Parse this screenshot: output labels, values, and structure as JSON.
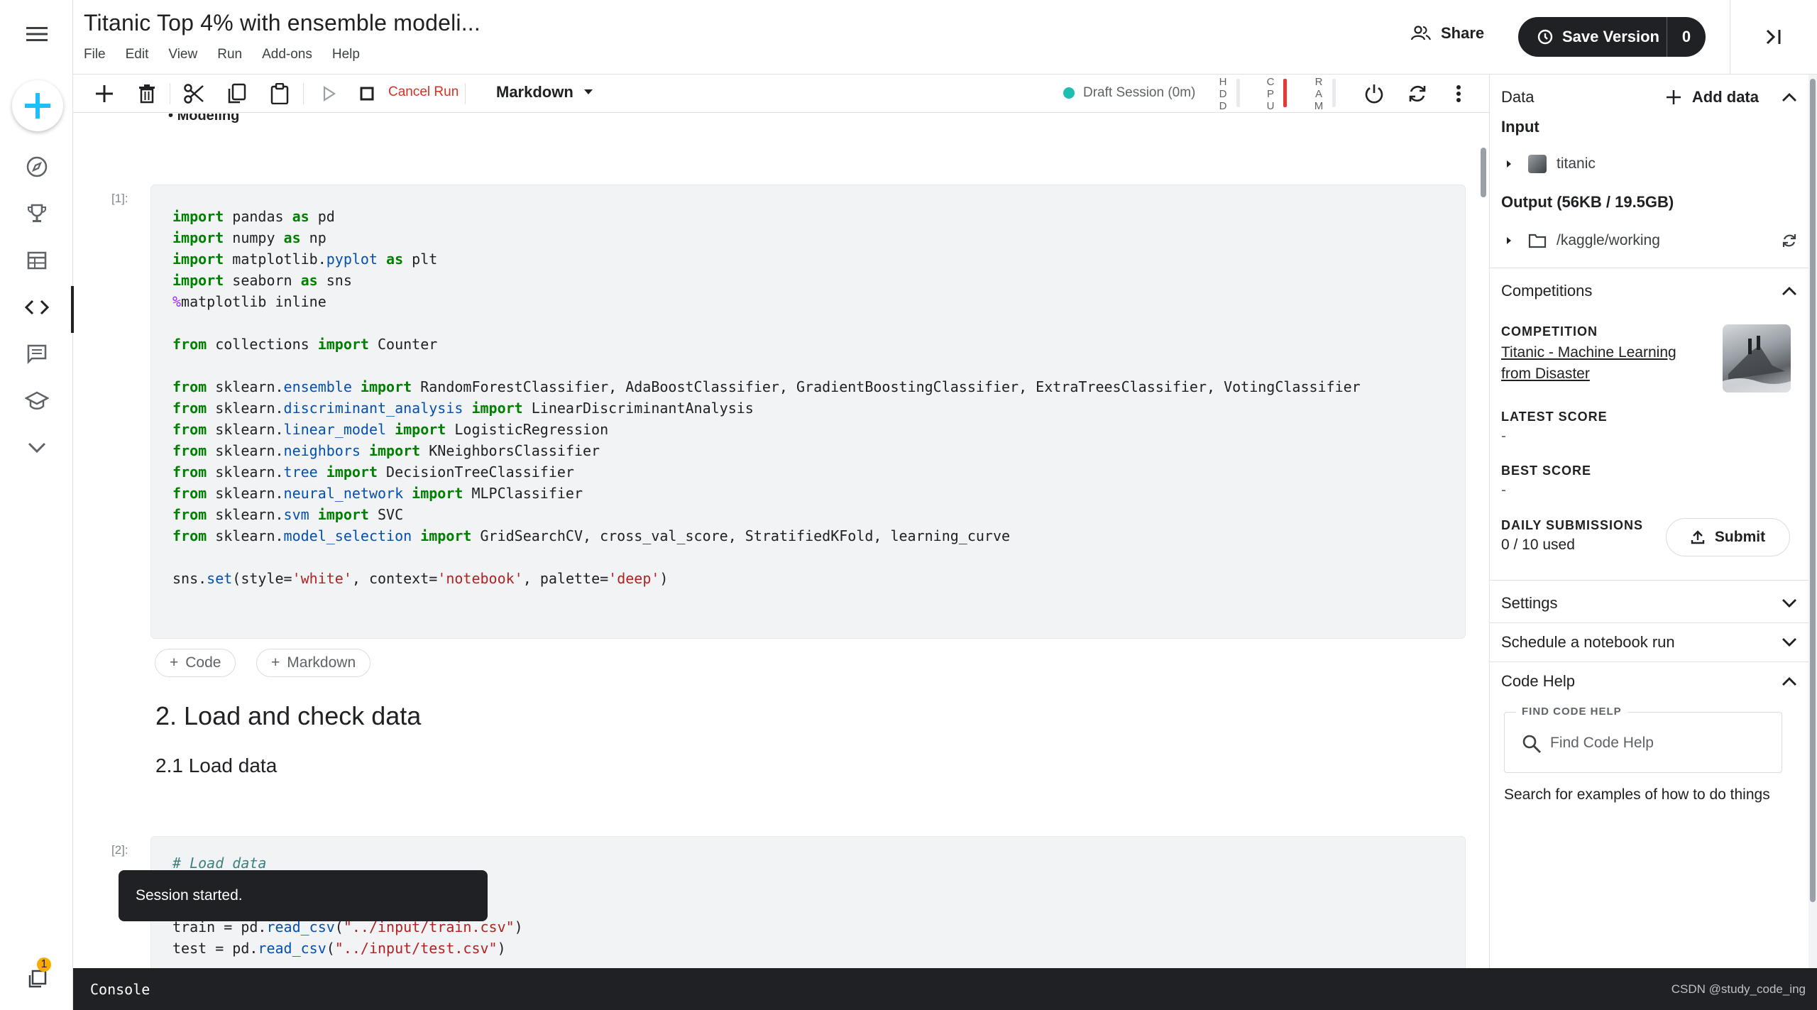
{
  "header": {
    "title": "Titanic Top 4% with ensemble modeli...",
    "menu": [
      "File",
      "Edit",
      "View",
      "Run",
      "Add-ons",
      "Help"
    ],
    "share_label": "Share",
    "save_label": "Save Version",
    "save_count": "0"
  },
  "toolbar": {
    "cancel_run": "Cancel Run",
    "cell_mode": "Markdown",
    "session": "Draft Session (0m)",
    "meters": {
      "hdd": "HDD",
      "cpu": "CPU",
      "ram": "RAM"
    }
  },
  "notebook": {
    "prev_bullet": "Modeling",
    "cell1_label": "[1]:",
    "cell1_lines": [
      "import pandas as pd",
      "import numpy as np",
      "import matplotlib.pyplot as plt",
      "import seaborn as sns",
      "%matplotlib inline",
      "",
      "from collections import Counter",
      "",
      "from sklearn.ensemble import RandomForestClassifier, AdaBoostClassifier, GradientBoostingClassifier, ExtraTreesClassifier, VotingClassifier",
      "from sklearn.discriminant_analysis import LinearDiscriminantAnalysis",
      "from sklearn.linear_model import LogisticRegression",
      "from sklearn.neighbors import KNeighborsClassifier",
      "from sklearn.tree import DecisionTreeClassifier",
      "from sklearn.neural_network import MLPClassifier",
      "from sklearn.svm import SVC",
      "from sklearn.model_selection import GridSearchCV, cross_val_score, StratifiedKFold, learning_curve",
      "",
      "sns.set(style='white', context='notebook', palette='deep')"
    ],
    "add_code": "Code",
    "add_markdown": "Markdown",
    "heading_2": "2. Load and check data",
    "heading_3": "2.1 Load data",
    "cell2_label": "[2]:",
    "cell2_lines": [
      "# Load data",
      "",
      "",
      "train = pd.read_csv(\"../input/train.csv\")",
      "test = pd.read_csv(\"../input/test.csv\")"
    ],
    "toast": "Session started."
  },
  "console": {
    "label": "Console",
    "watermark": "CSDN @study_code_ing"
  },
  "rail": {
    "notification_count": "1"
  },
  "panel": {
    "data_title": "Data",
    "add_data": "Add data",
    "input_heading": "Input",
    "input_item": "titanic",
    "output_heading": "Output (56KB / 19.5GB)",
    "output_item": "/kaggle/working",
    "competitions_title": "Competitions",
    "competition_caption": "COMPETITION",
    "competition_name_line1": "Titanic - Machine Learning",
    "competition_name_line2": "from Disaster",
    "latest_score_caption": "LATEST SCORE",
    "latest_score": "-",
    "best_score_caption": "BEST SCORE",
    "best_score": "-",
    "daily_caption": "DAILY SUBMISSIONS",
    "daily_value": "0 / 10 used",
    "submit": "Submit",
    "settings": "Settings",
    "schedule": "Schedule a notebook run",
    "code_help": "Code Help",
    "find_legend": "FIND CODE HELP",
    "find_placeholder": "Find Code Help",
    "help_text": "Search for examples of how to do things"
  },
  "colors": {
    "accent_blue": "#1a73e8",
    "fab_blue": "#20beff",
    "cancel_red": "#d93025",
    "session_green": "#20beb1",
    "dark": "#202124"
  }
}
